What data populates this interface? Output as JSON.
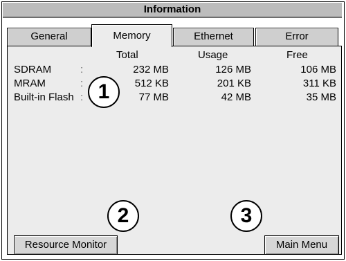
{
  "window": {
    "title": "Information"
  },
  "tabs": [
    {
      "label": "General",
      "active": false
    },
    {
      "label": "Memory",
      "active": true
    },
    {
      "label": "Ethernet",
      "active": false
    },
    {
      "label": "Error",
      "active": false
    }
  ],
  "memory_table": {
    "headers": {
      "total": "Total",
      "usage": "Usage",
      "free": "Free"
    },
    "rows": [
      {
        "name": "SDRAM",
        "sep": ":",
        "total": "232 MB",
        "usage": "126 MB",
        "free": "106 MB"
      },
      {
        "name": "MRAM",
        "sep": ":",
        "total": "512 KB",
        "usage": "201 KB",
        "free": "311 KB"
      },
      {
        "name": "Built-in Flash",
        "sep": ":",
        "total": "77 MB",
        "usage": "42 MB",
        "free": "35 MB"
      }
    ]
  },
  "buttons": {
    "resource_monitor": "Resource Monitor",
    "main_menu": "Main Menu"
  },
  "callouts": [
    "1",
    "2",
    "3"
  ]
}
